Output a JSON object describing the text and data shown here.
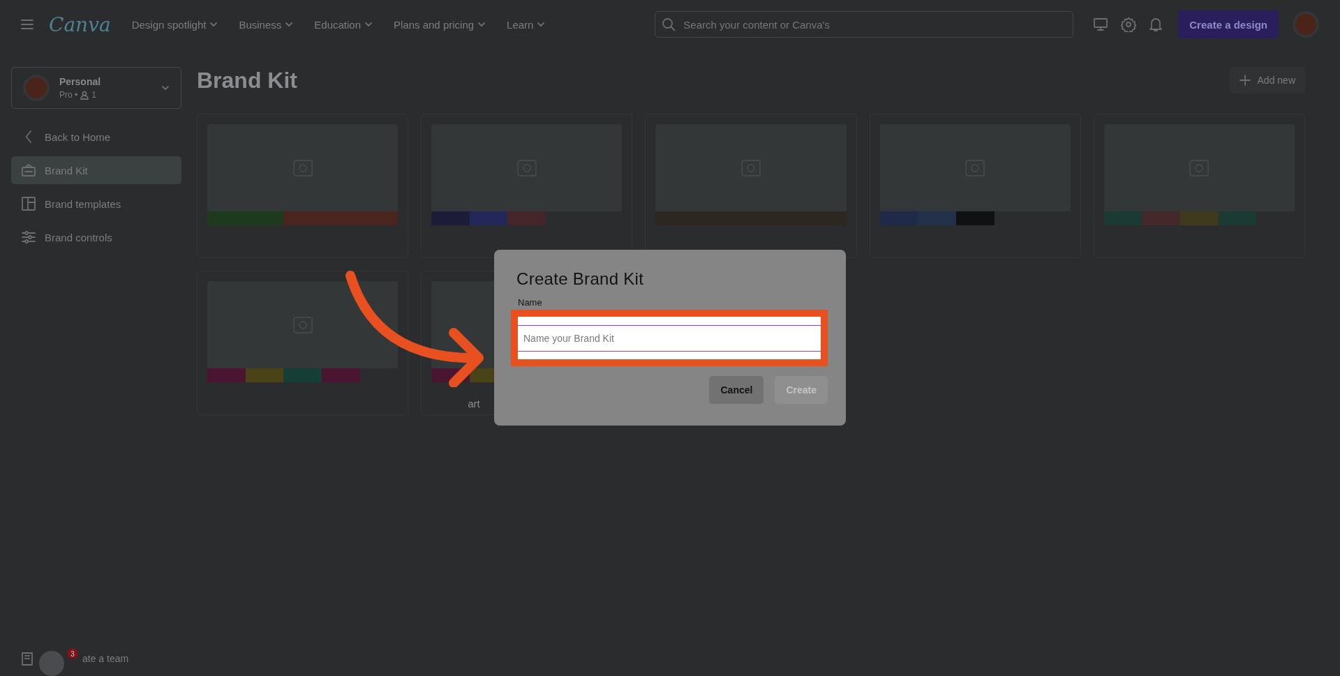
{
  "topbar": {
    "logo": "Canva",
    "nav": [
      {
        "label": "Design spotlight"
      },
      {
        "label": "Business"
      },
      {
        "label": "Education"
      },
      {
        "label": "Plans and pricing"
      },
      {
        "label": "Learn"
      }
    ],
    "search": {
      "placeholder": "Search your content or Canva's"
    },
    "create_button": "Create a design"
  },
  "sidebar": {
    "account": {
      "name": "Personal",
      "plan": "Pro •",
      "members": "1"
    },
    "items": [
      {
        "kind": "back",
        "label": "Back to Home",
        "selected": false
      },
      {
        "kind": "kit",
        "label": "Brand Kit",
        "selected": true
      },
      {
        "kind": "templates",
        "label": "Brand templates",
        "selected": false
      },
      {
        "kind": "controls",
        "label": "Brand controls",
        "selected": false
      }
    ],
    "footer_item": {
      "label": "ate a team",
      "badge": "3"
    }
  },
  "main": {
    "title": "Brand Kit",
    "add_button": "Add new",
    "kits": [
      {
        "image_icon": true,
        "swatches": [
          {
            "color": "#1d3a1f"
          },
          {
            "color": "#1d3a1f"
          },
          {
            "color": "#4a2520"
          },
          {
            "color": "#4a2520"
          },
          {
            "color": "#4a2520"
          }
        ]
      },
      {
        "image_icon": true,
        "swatches": [
          {
            "color": "#1c1b38"
          },
          {
            "color": "#24275a"
          },
          {
            "color": "#45242a"
          }
        ]
      },
      {
        "image_icon": true,
        "swatches": [
          {
            "color": "#2c2820"
          },
          {
            "color": "#2c2820"
          },
          {
            "color": "#2c2820"
          },
          {
            "color": "#2c2820"
          },
          {
            "color": "#2c2820"
          }
        ]
      },
      {
        "image_icon": true,
        "swatches": [
          {
            "color": "#1f2a4a"
          },
          {
            "color": "#22304a"
          },
          {
            "color": "#101112"
          }
        ]
      },
      {
        "image_icon": true,
        "swatches": [
          {
            "color": "#1b3a34"
          },
          {
            "color": "#45282a"
          },
          {
            "color": "#3e3a1e"
          },
          {
            "color": "#1b3a34"
          }
        ]
      },
      {
        "image_icon": true,
        "swatches": [
          {
            "color": "#4a1530"
          },
          {
            "color": "#4a4218"
          },
          {
            "color": "#163e36"
          },
          {
            "color": "#4a1530"
          }
        ]
      },
      {
        "title": "art",
        "swatches": [
          {
            "color": "#4a1530"
          },
          {
            "color": "#4a4218"
          }
        ]
      }
    ]
  },
  "dialog": {
    "title": "Create Brand Kit",
    "field_label": "Name",
    "placeholder": "Name your Brand Kit",
    "buttons": [
      {
        "label": "Cancel",
        "disabled": false
      },
      {
        "label": "Create",
        "disabled": true
      }
    ]
  }
}
